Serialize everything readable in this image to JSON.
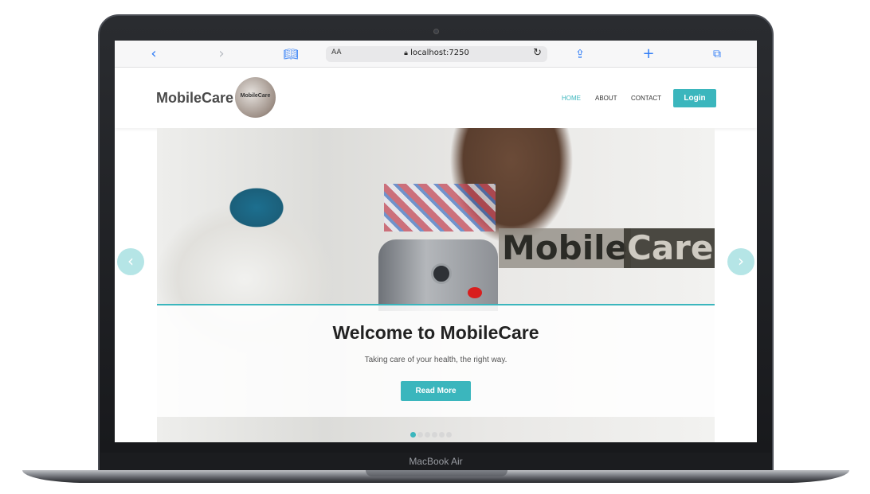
{
  "device": {
    "label": "MacBook Air"
  },
  "browser": {
    "url": "localhost:7250",
    "text_size_label": "AA",
    "icons": [
      "chevron-left-icon",
      "chevron-right-icon",
      "book-icon",
      "lock-icon",
      "reload-icon",
      "share-icon",
      "plus-icon",
      "tabs-icon"
    ]
  },
  "site": {
    "brand": "MobileCare",
    "logo_text": "MobileCare",
    "nav": [
      {
        "label": "HOME",
        "active": true
      },
      {
        "label": "ABOUT",
        "active": false
      },
      {
        "label": "CONTACT",
        "active": false
      }
    ],
    "login_label": "Login"
  },
  "hero": {
    "image_word_a": "Mobile",
    "image_word_b": "Care",
    "title": "Welcome to MobileCare",
    "subtitle": "Taking care of your health, the right way.",
    "cta_label": "Read More",
    "slide_count": 6,
    "active_slide": 1
  },
  "colors": {
    "accent": "#3bb6bd",
    "arrow": "#a3dee0",
    "nav_text": "#333333"
  }
}
